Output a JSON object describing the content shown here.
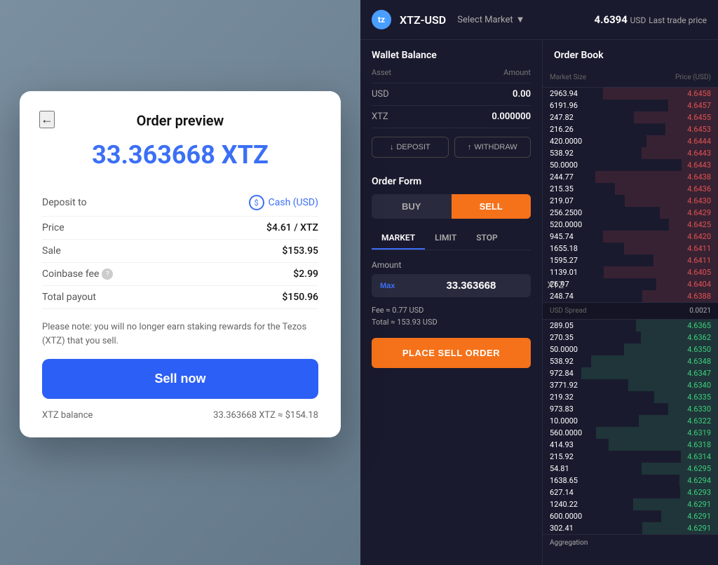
{
  "modal": {
    "back_label": "←",
    "title": "Order preview",
    "amount": "33.363668 XTZ",
    "deposit_to_label": "Deposit to",
    "deposit_to_value": "Cash (USD)",
    "price_label": "Price",
    "price_value": "$4.61 / XTZ",
    "sale_label": "Sale",
    "sale_value": "$153.95",
    "coinbase_fee_label": "Coinbase fee",
    "coinbase_fee_value": "$2.99",
    "total_payout_label": "Total payout",
    "total_payout_value": "$150.96",
    "note": "Please note: you will no longer earn staking rewards for the Tezos (XTZ) that you sell.",
    "sell_button": "Sell now",
    "xtz_balance_label": "XTZ balance",
    "xtz_balance_value": "33.363668 XTZ ≈ $154.18"
  },
  "trading": {
    "logo_symbol": "tz",
    "pair": "XTZ-USD",
    "select_market": "Select Market",
    "price": "4.6394",
    "price_currency": "USD",
    "last_trade_label": "Last trade price",
    "wallet": {
      "title": "Wallet Balance",
      "asset_header": "Asset",
      "amount_header": "Amount",
      "rows": [
        {
          "asset": "USD",
          "amount": "0.00"
        },
        {
          "asset": "XTZ",
          "amount": "0.000000"
        }
      ],
      "deposit_btn": "DEPOSIT",
      "withdraw_btn": "WITHDRAW"
    },
    "order_form": {
      "title": "Order Form",
      "buy_tab": "BUY",
      "sell_tab": "SELL",
      "market_tab": "MARKET",
      "limit_tab": "LIMIT",
      "stop_tab": "STOP",
      "amount_label": "Amount",
      "max_label": "Max",
      "amount_value": "33.363668",
      "amount_currency": "XTZ",
      "fee_label": "Fee ≈",
      "fee_value": "0.77 USD",
      "total_label": "Total ≈",
      "total_value": "153.93 USD",
      "place_order_btn": "PLACE SELL ORDER"
    },
    "order_book": {
      "title": "Order Book",
      "market_size_header": "Market Size",
      "price_header": "Price (USD)",
      "spread_label": "USD Spread",
      "spread_value": "0.0021",
      "aggregation_label": "Aggregation",
      "sell_rows": [
        {
          "size": "2963.94",
          "price": "4.6458"
        },
        {
          "size": "6191.96",
          "price": "4.6457"
        },
        {
          "size": "247.82",
          "price": "4.6455"
        },
        {
          "size": "216.26",
          "price": "4.6453"
        },
        {
          "size": "420.0000",
          "price": "4.6444"
        },
        {
          "size": "538.92",
          "price": "4.6443"
        },
        {
          "size": "50.0000",
          "price": "4.6443"
        },
        {
          "size": "244.77",
          "price": "4.6438"
        },
        {
          "size": "215.35",
          "price": "4.6436"
        },
        {
          "size": "219.07",
          "price": "4.6430"
        },
        {
          "size": "256.2500",
          "price": "4.6429"
        },
        {
          "size": "520.0000",
          "price": "4.6425"
        },
        {
          "size": "945.74",
          "price": "4.6420"
        },
        {
          "size": "1655.18",
          "price": "4.6411"
        },
        {
          "size": "1595.27",
          "price": "4.6411"
        },
        {
          "size": "1139.01",
          "price": "4.6405"
        },
        {
          "size": "26.97",
          "price": "4.6404"
        },
        {
          "size": "248.74",
          "price": "4.6388"
        }
      ],
      "buy_rows": [
        {
          "size": "289.05",
          "price": "4.6365"
        },
        {
          "size": "270.35",
          "price": "4.6362"
        },
        {
          "size": "50.0000",
          "price": "4.6350"
        },
        {
          "size": "538.92",
          "price": "4.6348"
        },
        {
          "size": "972.84",
          "price": "4.6347"
        },
        {
          "size": "3771.92",
          "price": "4.6340"
        },
        {
          "size": "219.32",
          "price": "4.6335"
        },
        {
          "size": "973.83",
          "price": "4.6330"
        },
        {
          "size": "10.0000",
          "price": "4.6322"
        },
        {
          "size": "560.0000",
          "price": "4.6319"
        },
        {
          "size": "414.93",
          "price": "4.6318"
        },
        {
          "size": "215.92",
          "price": "4.6314"
        },
        {
          "size": "54.81",
          "price": "4.6295"
        },
        {
          "size": "1638.65",
          "price": "4.6294"
        },
        {
          "size": "627.14",
          "price": "4.6293"
        },
        {
          "size": "1240.22",
          "price": "4.6291"
        },
        {
          "size": "600.0000",
          "price": "4.6291"
        },
        {
          "size": "302.41",
          "price": "4.6291"
        }
      ]
    }
  }
}
